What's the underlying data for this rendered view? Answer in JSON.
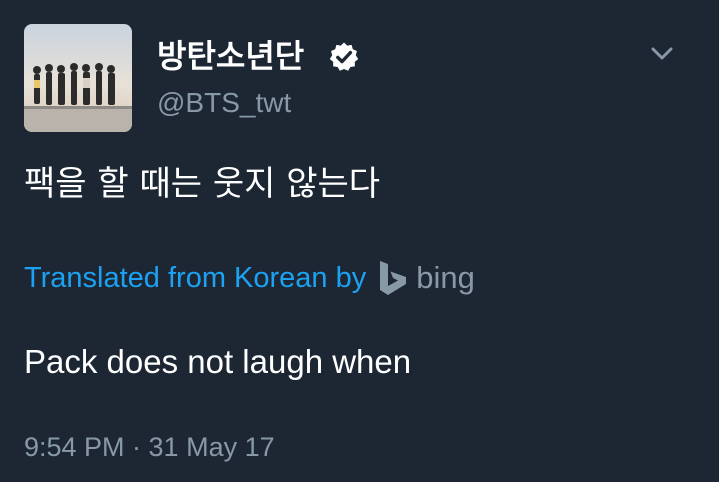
{
  "tweet": {
    "display_name": "방탄소년단",
    "handle": "@BTS_twt",
    "verified": true,
    "text": "팩을 할 때는 웃지 않는다",
    "translation": {
      "label": "Translated from Korean by",
      "provider": "bing",
      "text": "Pack does not laugh when"
    },
    "timestamp": "9:54 PM · 31 May 17"
  },
  "icons": {
    "verified": "verified-icon",
    "menu": "chevron-down-icon",
    "translator": "bing-logo-icon"
  },
  "colors": {
    "background": "#1c2733",
    "text_primary": "#ffffff",
    "text_secondary": "#8899a6",
    "link": "#1da1f2"
  }
}
